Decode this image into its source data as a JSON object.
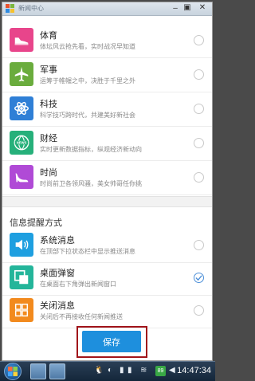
{
  "window": {
    "title": "新闻中心"
  },
  "categories": [
    {
      "id": "sports",
      "title": "体育",
      "desc": "体坛风云抢先看，实时战况早知道",
      "icon": "shoe-icon",
      "color": "#e8458b",
      "checked": false
    },
    {
      "id": "military",
      "title": "军事",
      "desc": "运筹于帷幄之中，决胜于千里之外",
      "icon": "airplane-icon",
      "color": "#6aac3d",
      "checked": false
    },
    {
      "id": "tech",
      "title": "科技",
      "desc": "科学技巧跨时代，共建美好新社会",
      "icon": "atom-icon",
      "color": "#2f7fd6",
      "checked": false
    },
    {
      "id": "finance",
      "title": "财经",
      "desc": "实时更新数据指标，纵观经济新动向",
      "icon": "news-globe-icon",
      "color": "#26b07a",
      "checked": false
    },
    {
      "id": "fashion",
      "title": "时尚",
      "desc": "时尚前卫各领风骚，美女帅哥任你挑",
      "icon": "high-heel-icon",
      "color": "#b04ad6",
      "checked": false
    }
  ],
  "reminder": {
    "section_title": "信息提醒方式",
    "options": [
      {
        "id": "system",
        "title": "系统消息",
        "desc": "在顶部下拉状态栏中显示推送消息",
        "icon": "speaker-icon",
        "color": "#1e9fe0",
        "checked": false
      },
      {
        "id": "desktop",
        "title": "桌面弹窗",
        "desc": "在桌面右下角弹出新闻窗口",
        "icon": "popup-window-icon",
        "color": "#24b59a",
        "checked": true
      },
      {
        "id": "off",
        "title": "关闭消息",
        "desc": "关闭后不再接收任何新闻推送",
        "icon": "grid-icon",
        "color": "#f28a1e",
        "checked": false
      }
    ]
  },
  "save_button": "保存",
  "taskbar": {
    "battery": "89",
    "clock": "14:47:34"
  }
}
